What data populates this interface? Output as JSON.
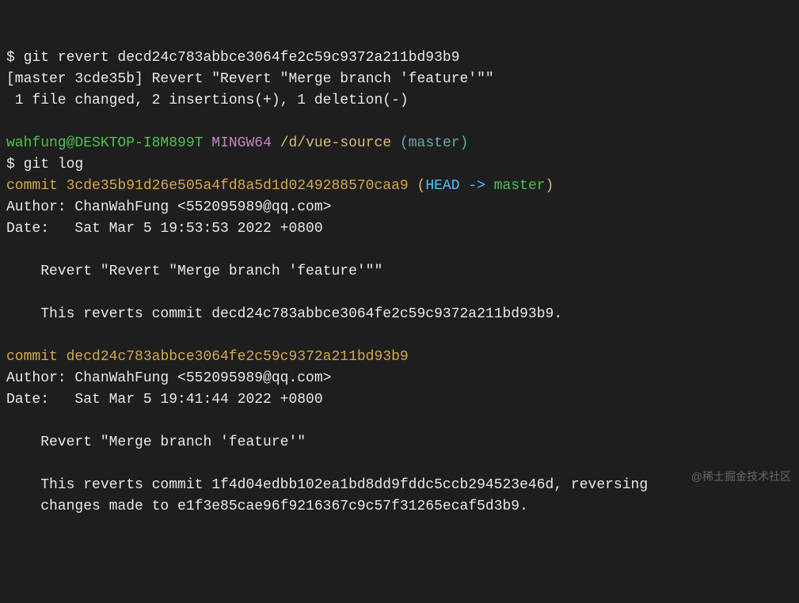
{
  "line1_prompt": "$ ",
  "line1_cmd": "git revert decd24c783abbce3064fe2c59c9372a211bd93b9",
  "line2": "[master 3cde35b] Revert \"Revert \"Merge branch 'feature'\"\"",
  "line3": " 1 file changed, 2 insertions(+), 1 deletion(-)",
  "prompt_user": "wahfung@DESKTOP-I8M899T",
  "prompt_mingw": "MINGW64",
  "prompt_path": "/d/vue-source",
  "prompt_branch": "(master)",
  "line5_prompt": "$ ",
  "line5_cmd": "git log",
  "commit1_label": "commit ",
  "commit1_hash": "3cde35b91d26e505a4fd8a5d1d0249288570caa9",
  "commit1_open": " (",
  "commit1_head": "HEAD -> ",
  "commit1_master": "master",
  "commit1_close": ")",
  "commit1_author": "Author: ChanWahFung <552095989@qq.com>",
  "commit1_date": "Date:   Sat Mar 5 19:53:53 2022 +0800",
  "commit1_msg1": "    Revert \"Revert \"Merge branch 'feature'\"\"",
  "commit1_msg2": "    This reverts commit decd24c783abbce3064fe2c59c9372a211bd93b9.",
  "commit2_label": "commit ",
  "commit2_hash": "decd24c783abbce3064fe2c59c9372a211bd93b9",
  "commit2_author": "Author: ChanWahFung <552095989@qq.com>",
  "commit2_date": "Date:   Sat Mar 5 19:41:44 2022 +0800",
  "commit2_msg1": "    Revert \"Merge branch 'feature'\"",
  "commit2_msg2": "    This reverts commit 1f4d04edbb102ea1bd8dd9fddc5ccb294523e46d, reversing",
  "commit2_msg3": "    changes made to e1f3e85cae96f9216367c9c57f31265ecaf5d3b9.",
  "watermark": "@稀土掘金技术社区"
}
